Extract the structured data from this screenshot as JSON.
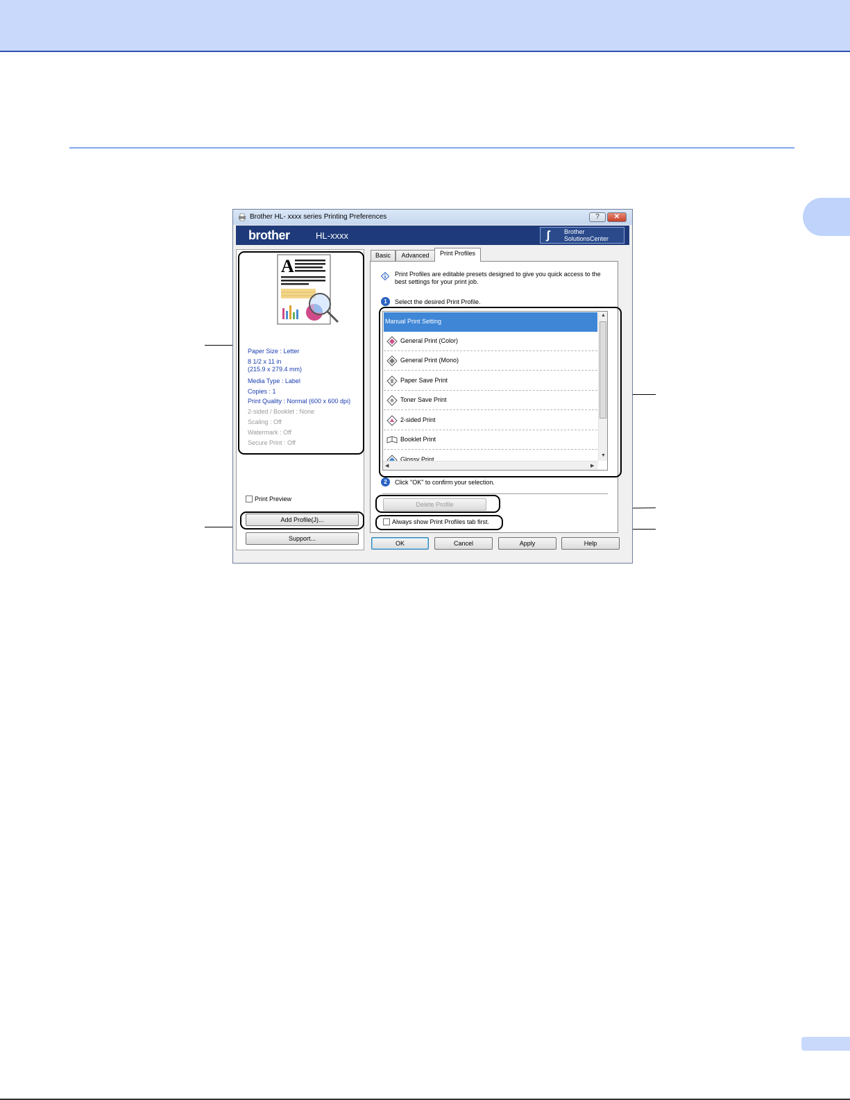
{
  "window": {
    "title": "Brother HL- xxxx  series Printing Preferences",
    "help_button": "?",
    "close_button": "✕"
  },
  "banner": {
    "brand": "brother",
    "model": "HL-xxxx",
    "solutions_center_line1": "Brother",
    "solutions_center_line2": "SolutionsCenter"
  },
  "summary": {
    "lines": [
      "Paper Size : Letter",
      "8 1/2 x 11 in",
      "(215.9 x 279.4 mm)",
      "Media Type : Label",
      "Copies : 1",
      "Print Quality : Normal (600 x 600 dpi)",
      "2-sided / Booklet : None",
      "Scaling : Off",
      "Watermark : Off",
      "Secure Print : Off"
    ]
  },
  "left": {
    "print_preview_label": "Print Preview",
    "add_profile_label": "Add Profile(J)...",
    "support_label": "Support..."
  },
  "tabs": [
    "Basic",
    "Advanced",
    "Print Profiles"
  ],
  "print_profiles": {
    "info_text": "Print Profiles are editable presets designed to give you quick access to the best settings for your print job.",
    "step1_num": "1",
    "step1_text": "Select the desired Print Profile.",
    "items": [
      "Manual Print Setting",
      "General Print (Color)",
      "General Print (Mono)",
      "Paper Save Print",
      "Toner Save Print",
      "2-sided Print",
      "Booklet Print",
      "Glossy Print"
    ],
    "step2_num": "2",
    "step2_text": "Click \"OK\" to confirm your selection.",
    "delete_profile_label": "Delete Profile",
    "always_show_label": "Always show Print Profiles tab first."
  },
  "footer": {
    "ok": "OK",
    "cancel": "Cancel",
    "apply": "Apply",
    "help": "Help"
  },
  "colors": {
    "selection": "#3f86d6",
    "banner": "#1f3a7a",
    "summary_text": "#1a3cb0",
    "page_header": "#c9d9fb"
  }
}
